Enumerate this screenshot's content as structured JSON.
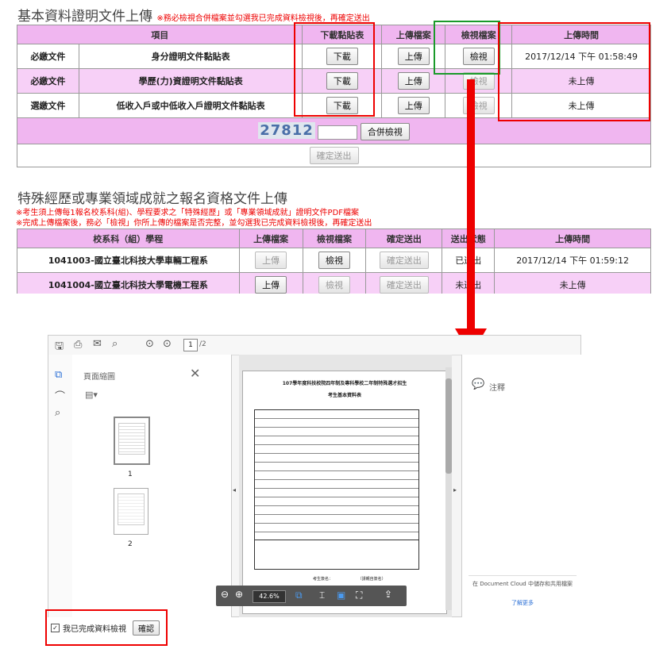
{
  "section1": {
    "title": "基本資料證明文件上傳",
    "note": "※務必檢視合併檔案並勾選我已完成資料檢視後，再確定送出",
    "headers": [
      "項目",
      "下載黏貼表",
      "上傳檔案",
      "檢視檔案",
      "上傳時間"
    ],
    "rows": [
      {
        "type": "必繳文件",
        "item": "身分證明文件黏貼表",
        "download": "下載",
        "upload": "上傳",
        "view": "檢視",
        "time": "2017/12/14 下午 01:58:49"
      },
      {
        "type": "必繳文件",
        "item": "學歷(力)資證明文件黏貼表",
        "download": "下載",
        "upload": "上傳",
        "view": "檢視",
        "time": "未上傳"
      },
      {
        "type": "選繳文件",
        "item": "低收入戶或中低收入戶證明文件黏貼表",
        "download": "下載",
        "upload": "上傳",
        "view": "檢視",
        "time": "未上傳"
      }
    ],
    "captcha": "27812",
    "merge_button": "合併檢視",
    "submit_button": "確定送出"
  },
  "section2": {
    "title": "特殊經歷或專業領域成就之報名資格文件上傳",
    "note1": "※考生須上傳每1報名校系科(組)、學程要求之「特殊經歷」或「專業領域成就」證明文件PDF檔案",
    "note2": "※完成上傳檔案後，務必「檢視」你所上傳的檔案是否完整，並勾選我已完成資料檢視後，再確定送出",
    "headers": [
      "校系科（組）學程",
      "上傳檔案",
      "檢視檔案",
      "確定送出",
      "送出狀態",
      "上傳時間"
    ],
    "rows": [
      {
        "dept": "1041003-國立臺北科技大學車輛工程系",
        "upload": "上傳",
        "view": "檢視",
        "submit": "確定送出",
        "status": "已送出",
        "time": "2017/12/14 下午 01:59:12"
      },
      {
        "dept": "1041004-國立臺北科技大學電機工程系",
        "upload": "上傳",
        "view": "檢視",
        "submit": "確定送出",
        "status": "未送出",
        "time": "未上傳"
      }
    ]
  },
  "viewer": {
    "page_current": "1",
    "page_total": "/2",
    "thumb_title": "頁面縮圖",
    "thumb_labels": [
      "1",
      "2"
    ],
    "doc_title_line1": "107學年度科技校院四年制及專科學校二年制特殊選才招生",
    "doc_title_line2": "考生基本資料表",
    "doc_signature": "考生簽名：",
    "doc_signature_note": "（請親自簽名）",
    "zoom": "42.6%",
    "comment_label": "注釋",
    "cloud_text": "在 Document Cloud 中儲存和共用檔案",
    "learn_more": "了解更多"
  },
  "confirm": {
    "checkbox_label": "我已完成資料檢視",
    "button": "確認"
  },
  "colors": {
    "accent_red": "#e00000",
    "header_pink": "#f0b6f0",
    "row_pink": "#f7d0f7",
    "green": "#1a9a2a"
  }
}
